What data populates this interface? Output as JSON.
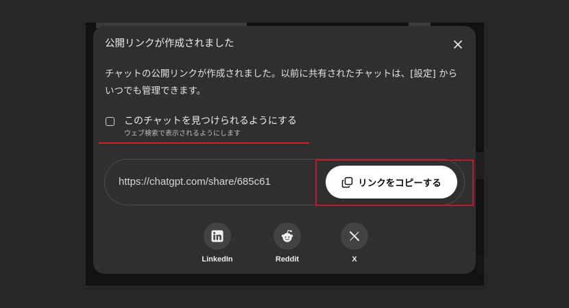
{
  "dialog": {
    "title": "公開リンクが作成されました",
    "description_main": "チャットの公開リンクが作成されました。以前に共有されたチャットは、",
    "settings_link": "[設定]",
    "description_tail": " からいつでも管理できます。"
  },
  "discoverable": {
    "label": "このチャットを見つけられるようにする",
    "sublabel": "ウェブ検索で表示されるようにします"
  },
  "share_link": {
    "url": "https://chatgpt.com/share/685c61",
    "copy_label": "リンクをコピーする"
  },
  "share_targets": [
    {
      "label": "LinkedIn"
    },
    {
      "label": "Reddit"
    },
    {
      "label": "X"
    }
  ],
  "icons": {
    "close": "close-icon",
    "copy": "copy-icon",
    "linkedin": "linkedin-icon",
    "reddit": "reddit-icon",
    "x": "x-icon"
  },
  "colors": {
    "modal_bg": "#2f2f2f",
    "highlight": "#c21826",
    "button_bg": "#ffffff"
  }
}
